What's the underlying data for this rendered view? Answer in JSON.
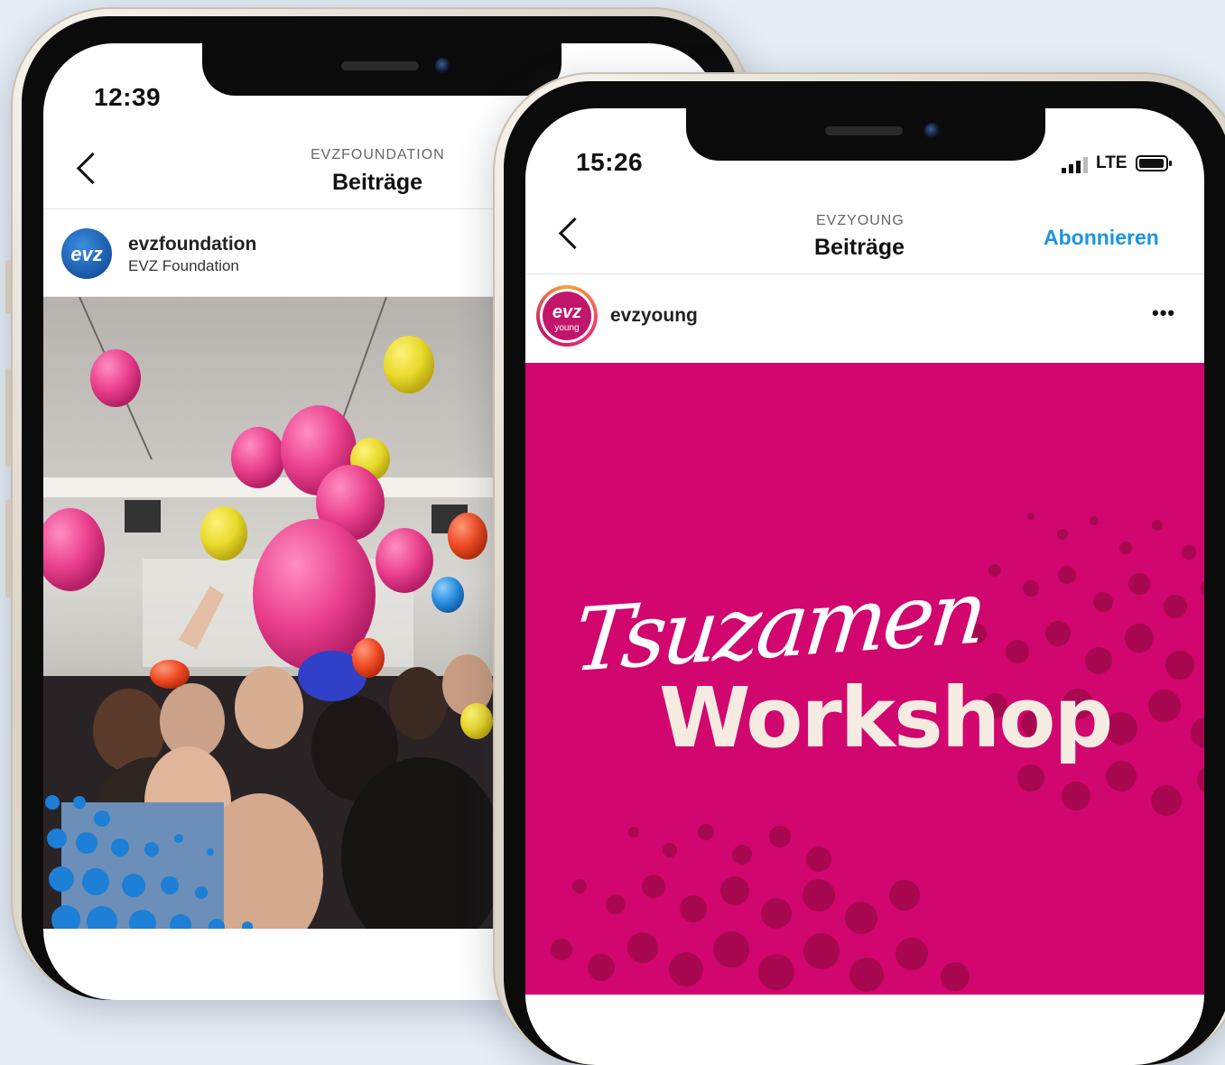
{
  "left_phone": {
    "status": {
      "time": "12:39"
    },
    "header": {
      "account": "EVZFOUNDATION",
      "title": "Beiträge"
    },
    "post": {
      "username": "evzfoundation",
      "fullname": "EVZ Foundation",
      "avatar_text": "evz"
    }
  },
  "right_phone": {
    "status": {
      "time": "15:26",
      "network": "LTE"
    },
    "header": {
      "account": "EVZYOUNG",
      "title": "Beiträge",
      "follow_label": "Abonnieren"
    },
    "post": {
      "username": "evzyoung",
      "avatar_text": "evz",
      "avatar_sub": "young",
      "more": "•••"
    },
    "graphic": {
      "script_word": "Tsuzamen",
      "main_word": "Workshop"
    }
  },
  "colors": {
    "accent_blue": "#1b95e0",
    "brand_magenta": "#d1066e",
    "evz_blue": "#1d5fae"
  }
}
